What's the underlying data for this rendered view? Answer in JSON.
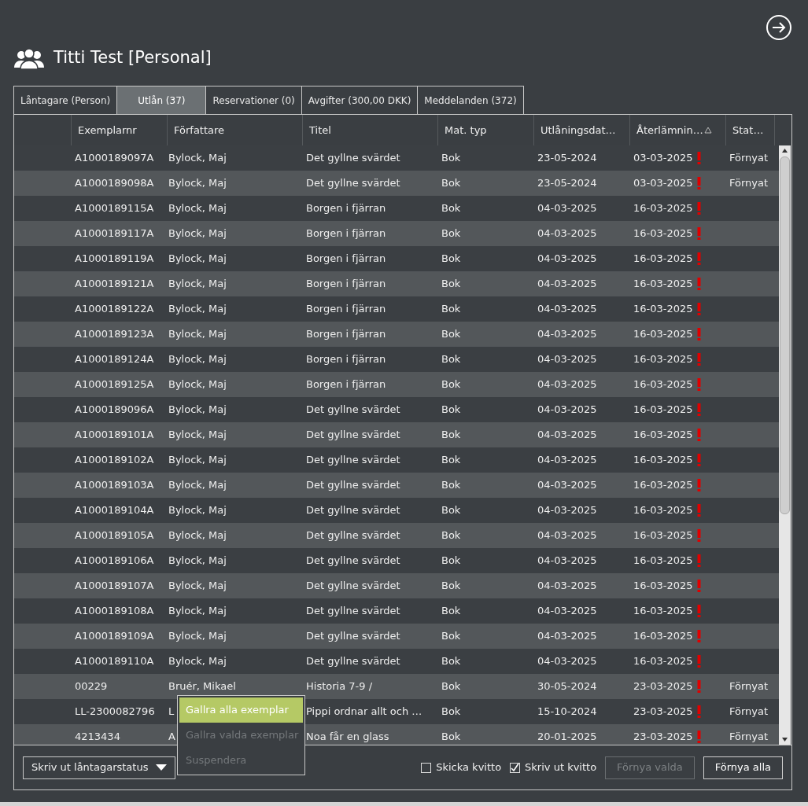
{
  "header": {
    "title": "Titti Test [Personal]"
  },
  "tabs": [
    {
      "label": "Låntagare (Person)",
      "selected": false
    },
    {
      "label": "Utlån (37)",
      "selected": true
    },
    {
      "label": "Reservationer (0)",
      "selected": false
    },
    {
      "label": "Avgifter (300,00 DKK)",
      "selected": false
    },
    {
      "label": "Meddelanden (372)",
      "selected": false
    }
  ],
  "table": {
    "columns": [
      {
        "label": "Exemplarnr",
        "sorted": false
      },
      {
        "label": "Författare",
        "sorted": false
      },
      {
        "label": "Titel",
        "sorted": false
      },
      {
        "label": "Mat. typ",
        "sorted": false
      },
      {
        "label": "Utlåningsdat…",
        "sorted": false
      },
      {
        "label": "Återlämnin…",
        "sorted": true
      },
      {
        "label": "Stat…",
        "sorted": false
      }
    ],
    "rows": [
      {
        "cells": [
          "A1000189097A",
          "Bylock, Maj",
          "Det gyllne svärdet",
          "Bok",
          "23-05-2024",
          "03-03-2025",
          "Förnyat"
        ],
        "overdue": true
      },
      {
        "cells": [
          "A1000189098A",
          "Bylock, Maj",
          "Det gyllne svärdet",
          "Bok",
          "23-05-2024",
          "03-03-2025",
          "Förnyat"
        ],
        "overdue": true
      },
      {
        "cells": [
          "A1000189115A",
          "Bylock, Maj",
          "Borgen i fjärran",
          "Bok",
          "04-03-2025",
          "16-03-2025",
          ""
        ],
        "overdue": true
      },
      {
        "cells": [
          "A1000189117A",
          "Bylock, Maj",
          "Borgen i fjärran",
          "Bok",
          "04-03-2025",
          "16-03-2025",
          ""
        ],
        "overdue": true
      },
      {
        "cells": [
          "A1000189119A",
          "Bylock, Maj",
          "Borgen i fjärran",
          "Bok",
          "04-03-2025",
          "16-03-2025",
          ""
        ],
        "overdue": true
      },
      {
        "cells": [
          "A1000189121A",
          "Bylock, Maj",
          "Borgen i fjärran",
          "Bok",
          "04-03-2025",
          "16-03-2025",
          ""
        ],
        "overdue": true
      },
      {
        "cells": [
          "A1000189122A",
          "Bylock, Maj",
          "Borgen i fjärran",
          "Bok",
          "04-03-2025",
          "16-03-2025",
          ""
        ],
        "overdue": true
      },
      {
        "cells": [
          "A1000189123A",
          "Bylock, Maj",
          "Borgen i fjärran",
          "Bok",
          "04-03-2025",
          "16-03-2025",
          ""
        ],
        "overdue": true
      },
      {
        "cells": [
          "A1000189124A",
          "Bylock, Maj",
          "Borgen i fjärran",
          "Bok",
          "04-03-2025",
          "16-03-2025",
          ""
        ],
        "overdue": true
      },
      {
        "cells": [
          "A1000189125A",
          "Bylock, Maj",
          "Borgen i fjärran",
          "Bok",
          "04-03-2025",
          "16-03-2025",
          ""
        ],
        "overdue": true
      },
      {
        "cells": [
          "A1000189096A",
          "Bylock, Maj",
          "Det gyllne svärdet",
          "Bok",
          "04-03-2025",
          "16-03-2025",
          ""
        ],
        "overdue": true
      },
      {
        "cells": [
          "A1000189101A",
          "Bylock, Maj",
          "Det gyllne svärdet",
          "Bok",
          "04-03-2025",
          "16-03-2025",
          ""
        ],
        "overdue": true
      },
      {
        "cells": [
          "A1000189102A",
          "Bylock, Maj",
          "Det gyllne svärdet",
          "Bok",
          "04-03-2025",
          "16-03-2025",
          ""
        ],
        "overdue": true
      },
      {
        "cells": [
          "A1000189103A",
          "Bylock, Maj",
          "Det gyllne svärdet",
          "Bok",
          "04-03-2025",
          "16-03-2025",
          ""
        ],
        "overdue": true
      },
      {
        "cells": [
          "A1000189104A",
          "Bylock, Maj",
          "Det gyllne svärdet",
          "Bok",
          "04-03-2025",
          "16-03-2025",
          ""
        ],
        "overdue": true
      },
      {
        "cells": [
          "A1000189105A",
          "Bylock, Maj",
          "Det gyllne svärdet",
          "Bok",
          "04-03-2025",
          "16-03-2025",
          ""
        ],
        "overdue": true
      },
      {
        "cells": [
          "A1000189106A",
          "Bylock, Maj",
          "Det gyllne svärdet",
          "Bok",
          "04-03-2025",
          "16-03-2025",
          ""
        ],
        "overdue": true
      },
      {
        "cells": [
          "A1000189107A",
          "Bylock, Maj",
          "Det gyllne svärdet",
          "Bok",
          "04-03-2025",
          "16-03-2025",
          ""
        ],
        "overdue": true
      },
      {
        "cells": [
          "A1000189108A",
          "Bylock, Maj",
          "Det gyllne svärdet",
          "Bok",
          "04-03-2025",
          "16-03-2025",
          ""
        ],
        "overdue": true
      },
      {
        "cells": [
          "A1000189109A",
          "Bylock, Maj",
          "Det gyllne svärdet",
          "Bok",
          "04-03-2025",
          "16-03-2025",
          ""
        ],
        "overdue": true
      },
      {
        "cells": [
          "A1000189110A",
          "Bylock, Maj",
          "Det gyllne svärdet",
          "Bok",
          "04-03-2025",
          "16-03-2025",
          ""
        ],
        "overdue": true
      },
      {
        "cells": [
          "00229",
          "Bruér, Mikael",
          "Historia 7-9 /",
          "Bok",
          "30-05-2024",
          "23-03-2025",
          "Förnyat"
        ],
        "overdue": true
      },
      {
        "cells": [
          "LL-2300082796",
          "L",
          "Pippi ordnar allt och …",
          "Bok",
          "15-10-2024",
          "23-03-2025",
          "Förnyat"
        ],
        "overdue": true
      },
      {
        "cells": [
          "4213434",
          "A",
          "Noa får en glass",
          "Bok",
          "20-01-2025",
          "23-03-2025",
          "Förnyat"
        ],
        "overdue": true
      }
    ]
  },
  "menu": {
    "items": [
      {
        "label": "Gallra alla exemplar",
        "selected": true,
        "disabled": false
      },
      {
        "label": "Gallra valda exemplar",
        "selected": false,
        "disabled": true
      },
      {
        "label": "Suspendera",
        "selected": false,
        "disabled": true
      }
    ]
  },
  "footer": {
    "dropdown": "Skriv ut låntagarstatus",
    "checkboxes": [
      {
        "label": "Skicka kvitto",
        "checked": false
      },
      {
        "label": "Skriv ut kvitto",
        "checked": true
      }
    ],
    "buttons": [
      {
        "label": "Förnya valda",
        "disabled": true
      },
      {
        "label": "Förnya alla",
        "disabled": false
      }
    ]
  }
}
